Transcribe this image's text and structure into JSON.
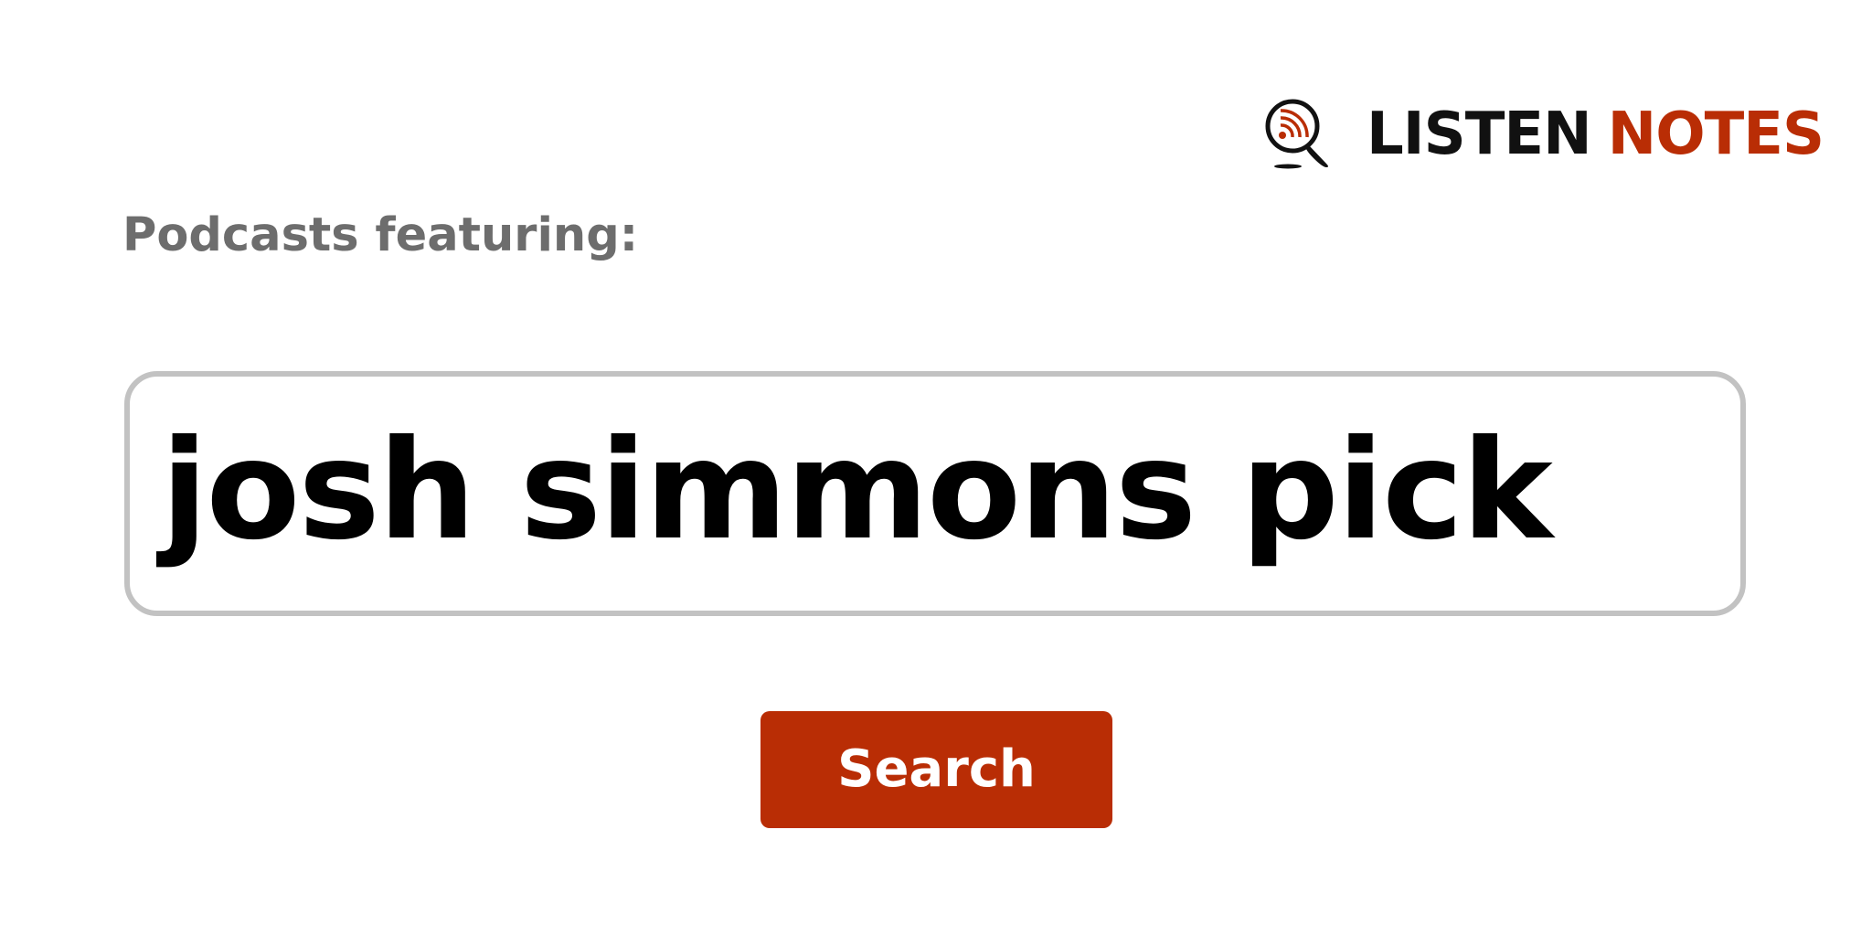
{
  "logo": {
    "word_primary": "LISTEN",
    "word_accent": "NOTES",
    "icon": "magnifier-podcast-icon",
    "colors": {
      "primary": "#111111",
      "accent": "#b92d05"
    }
  },
  "heading": "Podcasts featuring:",
  "search": {
    "value": "josh simmons pick"
  },
  "button": {
    "label": "Search",
    "color": "#b92d05"
  }
}
